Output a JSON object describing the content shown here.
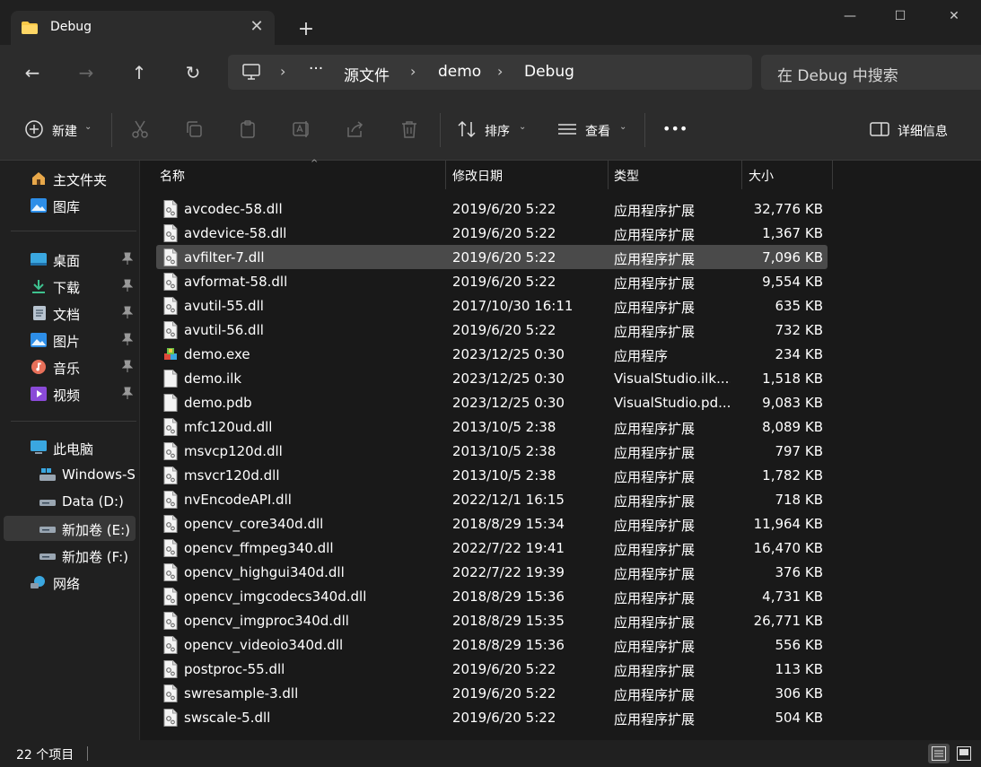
{
  "colors": {
    "accent": "#4cc2ff",
    "folder": "#f8c848",
    "background": "#191919",
    "chrome": "#2c2c2c"
  },
  "titlebar": {
    "tab_title": "Debug",
    "tab_icon": "folder-icon",
    "new_tab": "+",
    "min": "—",
    "max": "☐",
    "close": "✕"
  },
  "nav": {
    "back": "←",
    "forward": "→",
    "up": "↑",
    "refresh": "↻",
    "breadcrumb": [
      "源文件",
      "demo",
      "Debug"
    ],
    "more": "···",
    "search_placeholder": "在 Debug 中搜索"
  },
  "toolbar": {
    "new_label": "新建",
    "sort_label": "排序",
    "view_label": "查看",
    "more_label": "•••",
    "details_label": "详细信息"
  },
  "sidebar": {
    "quick": [
      {
        "label": "主文件夹",
        "icon": "home-icon"
      },
      {
        "label": "图库",
        "icon": "gallery-icon"
      }
    ],
    "pinned": [
      {
        "label": "桌面",
        "icon": "desktop-icon"
      },
      {
        "label": "下载",
        "icon": "download-icon"
      },
      {
        "label": "文档",
        "icon": "document-icon"
      },
      {
        "label": "图片",
        "icon": "pictures-icon"
      },
      {
        "label": "音乐",
        "icon": "music-icon"
      },
      {
        "label": "视频",
        "icon": "video-icon"
      }
    ],
    "pc": [
      {
        "label": "此电脑",
        "icon": "pc-icon"
      },
      {
        "label": "Windows-S",
        "icon": "windows-drive-icon"
      },
      {
        "label": "Data (D:)",
        "icon": "drive-icon"
      },
      {
        "label": "新加卷 (E:)",
        "icon": "drive-icon",
        "selected": true
      },
      {
        "label": "新加卷 (F:)",
        "icon": "drive-icon"
      },
      {
        "label": "网络",
        "icon": "network-icon"
      }
    ]
  },
  "columns": {
    "name": "名称",
    "date": "修改日期",
    "type": "类型",
    "size": "大小"
  },
  "files": [
    {
      "name": "avcodec-58.dll",
      "date": "2019/6/20 5:22",
      "type": "应用程序扩展",
      "size": "32,776 KB",
      "icon": "dll"
    },
    {
      "name": "avdevice-58.dll",
      "date": "2019/6/20 5:22",
      "type": "应用程序扩展",
      "size": "1,367 KB",
      "icon": "dll"
    },
    {
      "name": "avfilter-7.dll",
      "date": "2019/6/20 5:22",
      "type": "应用程序扩展",
      "size": "7,096 KB",
      "icon": "dll",
      "selected": true
    },
    {
      "name": "avformat-58.dll",
      "date": "2019/6/20 5:22",
      "type": "应用程序扩展",
      "size": "9,554 KB",
      "icon": "dll"
    },
    {
      "name": "avutil-55.dll",
      "date": "2017/10/30 16:11",
      "type": "应用程序扩展",
      "size": "635 KB",
      "icon": "dll"
    },
    {
      "name": "avutil-56.dll",
      "date": "2019/6/20 5:22",
      "type": "应用程序扩展",
      "size": "732 KB",
      "icon": "dll"
    },
    {
      "name": "demo.exe",
      "date": "2023/12/25 0:30",
      "type": "应用程序",
      "size": "234 KB",
      "icon": "exe"
    },
    {
      "name": "demo.ilk",
      "date": "2023/12/25 0:30",
      "type": "VisualStudio.ilk....",
      "size": "1,518 KB",
      "icon": "blank"
    },
    {
      "name": "demo.pdb",
      "date": "2023/12/25 0:30",
      "type": "VisualStudio.pd...",
      "size": "9,083 KB",
      "icon": "blank"
    },
    {
      "name": "mfc120ud.dll",
      "date": "2013/10/5 2:38",
      "type": "应用程序扩展",
      "size": "8,089 KB",
      "icon": "dll"
    },
    {
      "name": "msvcp120d.dll",
      "date": "2013/10/5 2:38",
      "type": "应用程序扩展",
      "size": "797 KB",
      "icon": "dll"
    },
    {
      "name": "msvcr120d.dll",
      "date": "2013/10/5 2:38",
      "type": "应用程序扩展",
      "size": "1,782 KB",
      "icon": "dll"
    },
    {
      "name": "nvEncodeAPI.dll",
      "date": "2022/12/1 16:15",
      "type": "应用程序扩展",
      "size": "718 KB",
      "icon": "dll"
    },
    {
      "name": "opencv_core340d.dll",
      "date": "2018/8/29 15:34",
      "type": "应用程序扩展",
      "size": "11,964 KB",
      "icon": "dll"
    },
    {
      "name": "opencv_ffmpeg340.dll",
      "date": "2022/7/22 19:41",
      "type": "应用程序扩展",
      "size": "16,470 KB",
      "icon": "dll"
    },
    {
      "name": "opencv_highgui340d.dll",
      "date": "2022/7/22 19:39",
      "type": "应用程序扩展",
      "size": "376 KB",
      "icon": "dll"
    },
    {
      "name": "opencv_imgcodecs340d.dll",
      "date": "2018/8/29 15:36",
      "type": "应用程序扩展",
      "size": "4,731 KB",
      "icon": "dll"
    },
    {
      "name": "opencv_imgproc340d.dll",
      "date": "2018/8/29 15:35",
      "type": "应用程序扩展",
      "size": "26,771 KB",
      "icon": "dll"
    },
    {
      "name": "opencv_videoio340d.dll",
      "date": "2018/8/29 15:36",
      "type": "应用程序扩展",
      "size": "556 KB",
      "icon": "dll"
    },
    {
      "name": "postproc-55.dll",
      "date": "2019/6/20 5:22",
      "type": "应用程序扩展",
      "size": "113 KB",
      "icon": "dll"
    },
    {
      "name": "swresample-3.dll",
      "date": "2019/6/20 5:22",
      "type": "应用程序扩展",
      "size": "306 KB",
      "icon": "dll"
    },
    {
      "name": "swscale-5.dll",
      "date": "2019/6/20 5:22",
      "type": "应用程序扩展",
      "size": "504 KB",
      "icon": "dll"
    }
  ],
  "status": {
    "item_count": "22 个项目"
  }
}
